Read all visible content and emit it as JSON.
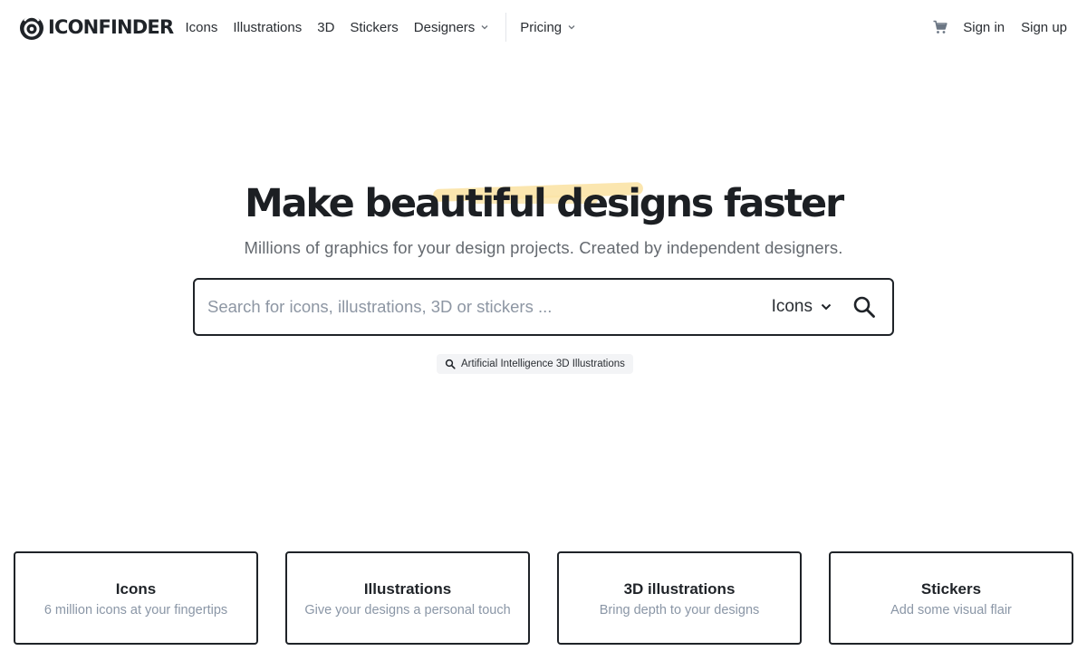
{
  "brand": {
    "logo_text": "ICONFINDER"
  },
  "nav": {
    "items": [
      {
        "label": "Icons"
      },
      {
        "label": "Illustrations"
      },
      {
        "label": "3D"
      },
      {
        "label": "Stickers"
      },
      {
        "label": "Designers"
      },
      {
        "label": "Pricing"
      }
    ],
    "cart_icon": "cart-icon",
    "sign_in": "Sign in",
    "sign_up": "Sign up"
  },
  "hero": {
    "title": "Make beautiful designs faster",
    "subtitle": "Millions of graphics for your design projects. Created by independent designers.",
    "highlight_color": "#fbe3a6"
  },
  "search": {
    "placeholder": "Search for icons, illustrations, 3D or stickers ...",
    "value": "",
    "type_selected": "Icons",
    "search_icon": "search-icon",
    "suggestion": "Artificial Intelligence 3D Illustrations"
  },
  "cards": [
    {
      "title": "Icons",
      "desc": "6 million icons at your fingertips"
    },
    {
      "title": "Illustrations",
      "desc": "Give your designs a personal touch"
    },
    {
      "title": "3D illustrations",
      "desc": "Bring depth to your designs"
    },
    {
      "title": "Stickers",
      "desc": "Add some visual flair"
    }
  ],
  "colors": {
    "text_dark": "#1f2328",
    "muted": "#656a70",
    "card_desc": "#8a96a6"
  }
}
